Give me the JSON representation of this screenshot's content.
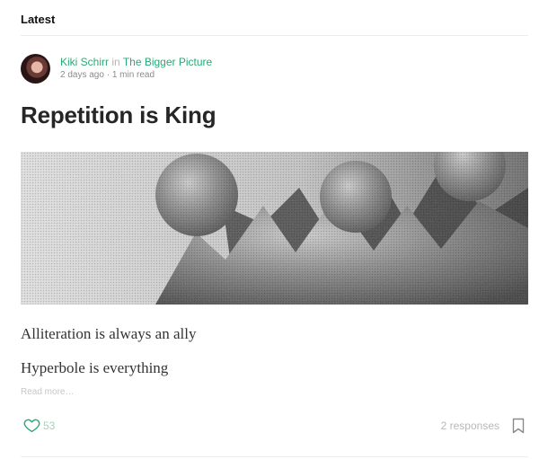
{
  "section": {
    "title": "Latest"
  },
  "post": {
    "author": "Kiki Schirr",
    "in_word": "in",
    "publication": "The Bigger Picture",
    "meta": "2 days ago · 1 min read",
    "title": "Repetition is King",
    "lines": [
      "Alliteration is always an ally",
      "Hyperbole is everything"
    ],
    "read_more": "Read more…",
    "likes": "53",
    "responses": "2 responses"
  },
  "colors": {
    "accent": "#2aa876",
    "like": "#7fcfa6"
  },
  "icons": {
    "like": "heart-icon",
    "save": "bookmark-icon"
  }
}
